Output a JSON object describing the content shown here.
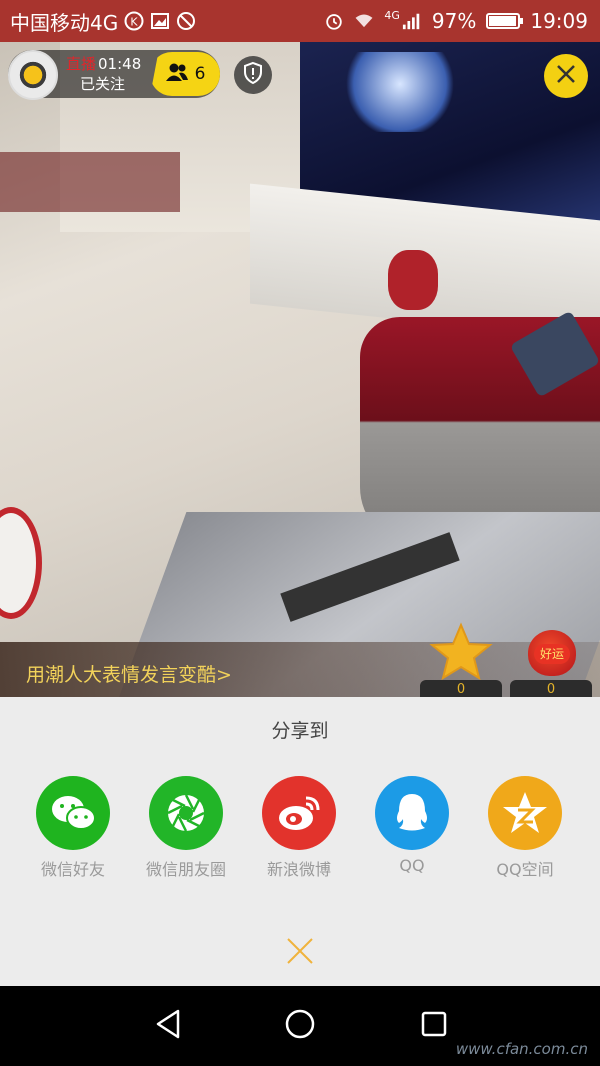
{
  "status_bar": {
    "carrier": "中国移动4G",
    "network": "4G",
    "battery_percent": "97%",
    "battery_level": 0.97,
    "time": "19:09"
  },
  "live": {
    "live_label": "直播",
    "duration": "01:48",
    "follow_status": "已关注",
    "viewer_count": "6"
  },
  "hint": {
    "text": "用潮人大表情发言变酷>"
  },
  "gifts": [
    {
      "count": "0"
    },
    {
      "badge": "好运",
      "count": "0"
    }
  ],
  "share_sheet": {
    "title": "分享到",
    "targets": [
      {
        "label": "微信好友",
        "icon": "wechat-icon",
        "color": "#1fb41f"
      },
      {
        "label": "微信朋友圈",
        "icon": "moments-icon",
        "color": "#22b528"
      },
      {
        "label": "新浪微博",
        "icon": "weibo-icon",
        "color": "#e2332c"
      },
      {
        "label": "QQ",
        "icon": "qq-icon",
        "color": "#1c9be6"
      },
      {
        "label": "QQ空间",
        "icon": "qzone-icon",
        "color": "#f0a81a"
      }
    ]
  },
  "colors": {
    "status_bar": "#a8342e",
    "accent_yellow": "#f3d012",
    "live_red": "#e0262b"
  },
  "watermark": "www.cfan.com.cn"
}
